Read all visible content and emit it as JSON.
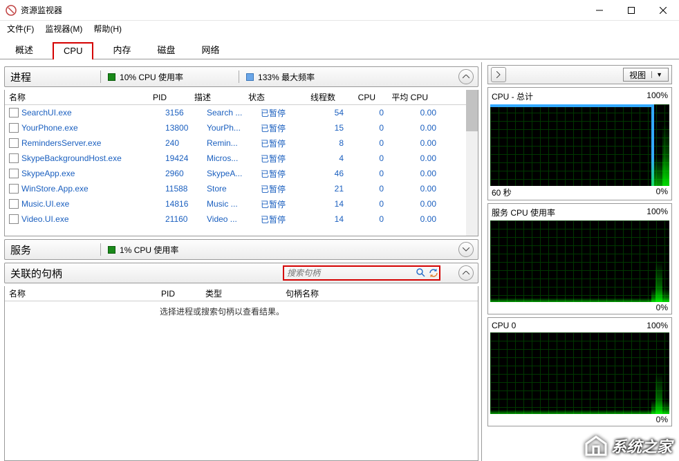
{
  "window": {
    "title": "资源监视器"
  },
  "menu": {
    "file": "文件(F)",
    "monitor": "监视器(M)",
    "help": "帮助(H)"
  },
  "tabs": {
    "overview": "概述",
    "cpu": "CPU",
    "memory": "内存",
    "disk": "磁盘",
    "network": "网络"
  },
  "processes": {
    "title": "进程",
    "cpu_usage_label": "10% CPU 使用率",
    "max_freq_label": "133% 最大频率",
    "columns": {
      "name": "名称",
      "pid": "PID",
      "desc": "描述",
      "state": "状态",
      "threads": "线程数",
      "cpu": "CPU",
      "avg": "平均 CPU"
    },
    "rows": [
      {
        "name": "SearchUI.exe",
        "pid": "3156",
        "desc": "Search ...",
        "state": "已暂停",
        "threads": "54",
        "cpu": "0",
        "avg": "0.00"
      },
      {
        "name": "YourPhone.exe",
        "pid": "13800",
        "desc": "YourPh...",
        "state": "已暂停",
        "threads": "15",
        "cpu": "0",
        "avg": "0.00"
      },
      {
        "name": "RemindersServer.exe",
        "pid": "240",
        "desc": "Remin...",
        "state": "已暂停",
        "threads": "8",
        "cpu": "0",
        "avg": "0.00"
      },
      {
        "name": "SkypeBackgroundHost.exe",
        "pid": "19424",
        "desc": "Micros...",
        "state": "已暂停",
        "threads": "4",
        "cpu": "0",
        "avg": "0.00"
      },
      {
        "name": "SkypeApp.exe",
        "pid": "2960",
        "desc": "SkypeA...",
        "state": "已暂停",
        "threads": "46",
        "cpu": "0",
        "avg": "0.00"
      },
      {
        "name": "WinStore.App.exe",
        "pid": "11588",
        "desc": "Store",
        "state": "已暂停",
        "threads": "21",
        "cpu": "0",
        "avg": "0.00"
      },
      {
        "name": "Music.UI.exe",
        "pid": "14816",
        "desc": "Music ...",
        "state": "已暂停",
        "threads": "14",
        "cpu": "0",
        "avg": "0.00"
      },
      {
        "name": "Video.UI.exe",
        "pid": "21160",
        "desc": "Video ...",
        "state": "已暂停",
        "threads": "14",
        "cpu": "0",
        "avg": "0.00"
      }
    ]
  },
  "services": {
    "title": "服务",
    "cpu_usage_label": "1% CPU 使用率"
  },
  "handles": {
    "title": "关联的句柄",
    "search_placeholder": "搜索句柄",
    "columns": {
      "name": "名称",
      "pid": "PID",
      "type": "类型",
      "handle_name": "句柄名称"
    },
    "empty_msg": "选择进程或搜索句柄以查看结果。"
  },
  "right": {
    "view_label": "视图",
    "graphs": [
      {
        "title": "CPU - 总计",
        "max": "100%",
        "footer_left": "60 秒",
        "footer_right": "0%"
      },
      {
        "title": "服务 CPU 使用率",
        "max": "100%",
        "footer_left": "",
        "footer_right": "0%"
      },
      {
        "title": "CPU 0",
        "max": "100%",
        "footer_left": "",
        "footer_right": "0%"
      }
    ]
  },
  "watermark": "系统之家"
}
